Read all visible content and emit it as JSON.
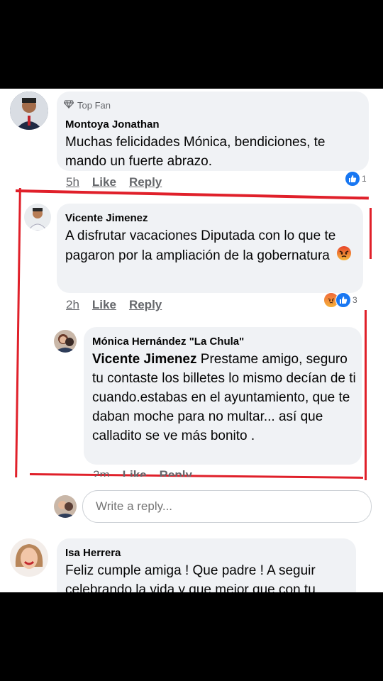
{
  "comments": [
    {
      "badge": "Top Fan",
      "name": "Montoya Jonathan",
      "text": "Muchas felicidades Mónica, bendiciones, te mando un fuerte abrazo.",
      "time": "5h",
      "like": "Like",
      "reply": "Reply",
      "reaction_count": "1"
    },
    {
      "name": "Vicente Jimenez",
      "text": "A disfrutar vacaciones Diputada con lo que te pagaron  por la ampliación de la gobernatura",
      "time": "2h",
      "like": "Like",
      "reply": "Reply",
      "reaction_count": "3"
    },
    {
      "name": "Mónica Hernández \"La Chula\"",
      "mention": "Vicente Jimenez",
      "text": " Prestame amigo, seguro tu contaste los billetes  lo mismo decían de ti cuando.estabas en el ayuntamiento,  que te daban moche para no multar... así que calladito se ve más bonito .",
      "time": "2m",
      "like": "Like",
      "reply": "Reply"
    },
    {
      "name": "Isa Herrera",
      "text": "Feliz cumple amiga ! Que padre ! A seguir celebrando la vida y que mejor que con tu"
    }
  ],
  "reply_input": {
    "placeholder": "Write a reply..."
  },
  "colors": {
    "highlight": "#e0202a",
    "like_blue": "#1877f2",
    "bubble": "#f0f2f5"
  },
  "icons": [
    "diamond-icon",
    "like-reaction-icon",
    "angry-reaction-icon",
    "angry-emoji-icon"
  ]
}
